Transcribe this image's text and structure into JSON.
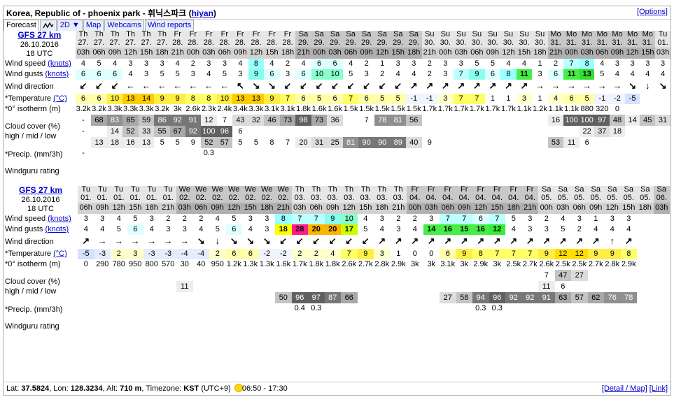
{
  "header": {
    "title": "Korea, Republic of - phoenix park - 휘닉스파크",
    "user_prefix": "(",
    "user": "hiyan",
    "user_suffix": ")",
    "options": "[Options]"
  },
  "tabs": [
    {
      "label": "Forecast",
      "active": true
    },
    {
      "label": "",
      "icon": "graph-icon"
    },
    {
      "label": "2D ▼"
    },
    {
      "label": "Map"
    },
    {
      "label": "Webcams"
    },
    {
      "label": "Wind reports"
    }
  ],
  "labels": {
    "wind_speed": "Wind speed",
    "wind_gusts": "Wind gusts",
    "knots": "(knots)",
    "wind_direction": "Wind direction",
    "temperature": "*Temperature",
    "deg_c": "(°C)",
    "isotherm": "*0° isotherm (m)",
    "cloud_cover_1": "Cloud cover (%)",
    "cloud_cover_2": "high / mid / low",
    "precip": "*Precip. (mm/3h)",
    "rating": "Windguru rating"
  },
  "colors": {
    "cloud": [
      "#ffffff",
      "#dcdcdc",
      "#c0c0c0",
      "#a0a0a0",
      "#808080",
      "#606060"
    ],
    "temp_warm": "#ffff80",
    "temp_hot": "#ffd200",
    "temp_cold": "#e0e8ff"
  },
  "sections": [
    {
      "model": "GFS 27 km",
      "date": "26.10.2016",
      "run": "18 UTC",
      "days": [
        "Th",
        "Th",
        "Th",
        "Th",
        "Th",
        "Th",
        "Fr",
        "Fr",
        "Fr",
        "Fr",
        "Fr",
        "Fr",
        "Fr",
        "Fr",
        "Sa",
        "Sa",
        "Sa",
        "Sa",
        "Sa",
        "Sa",
        "Sa",
        "Sa",
        "Su",
        "Su",
        "Su",
        "Su",
        "Su",
        "Su",
        "Su",
        "Su",
        "Mo",
        "Mo",
        "Mo",
        "Mo",
        "Mo",
        "Mo",
        "Mo",
        "Tu"
      ],
      "dates": [
        "27.",
        "27.",
        "27.",
        "27.",
        "27.",
        "27.",
        "28.",
        "28.",
        "28.",
        "28.",
        "28.",
        "28.",
        "28.",
        "28.",
        "29.",
        "29.",
        "29.",
        "29.",
        "29.",
        "29.",
        "29.",
        "29.",
        "30.",
        "30.",
        "30.",
        "30.",
        "30.",
        "30.",
        "30.",
        "30.",
        "31.",
        "31.",
        "31.",
        "31.",
        "31.",
        "31.",
        "31.",
        "01."
      ],
      "hours": [
        "03h",
        "06h",
        "09h",
        "12h",
        "15h",
        "18h",
        "21h",
        "00h",
        "03h",
        "06h",
        "09h",
        "12h",
        "15h",
        "18h",
        "21h",
        "00h",
        "03h",
        "06h",
        "09h",
        "12h",
        "15h",
        "18h",
        "21h",
        "00h",
        "03h",
        "06h",
        "09h",
        "12h",
        "15h",
        "18h",
        "21h",
        "00h",
        "03h",
        "06h",
        "09h",
        "12h",
        "15h",
        "03h"
      ],
      "weekend": [
        0,
        0,
        0,
        0,
        0,
        0,
        0,
        0,
        0,
        0,
        0,
        0,
        0,
        0,
        1,
        1,
        1,
        1,
        1,
        1,
        1,
        1,
        0,
        0,
        0,
        0,
        0,
        0,
        0,
        0,
        1,
        1,
        1,
        1,
        1,
        1,
        1,
        0
      ],
      "wind_speed": [
        4,
        5,
        4,
        3,
        3,
        3,
        4,
        2,
        3,
        3,
        4,
        8,
        4,
        2,
        4,
        6,
        6,
        4,
        2,
        1,
        3,
        3,
        2,
        3,
        3,
        5,
        5,
        4,
        4,
        1,
        2,
        7,
        8,
        4,
        3,
        3,
        3,
        3
      ],
      "wind_gusts": [
        6,
        6,
        6,
        4,
        3,
        5,
        5,
        3,
        4,
        5,
        3,
        9,
        6,
        3,
        6,
        10,
        10,
        5,
        3,
        2,
        4,
        4,
        2,
        3,
        7,
        9,
        6,
        8,
        11,
        3,
        6,
        11,
        13,
        5,
        4,
        4,
        4,
        4
      ],
      "wind_dir": [
        "↙",
        "↙",
        "↙",
        "←",
        "←",
        "←",
        "←",
        "←",
        "←",
        "←",
        "↖",
        "↘",
        "↘",
        "↙",
        "↙",
        "↙",
        "↙",
        "↙",
        "↙",
        "↙",
        "↙",
        "↗",
        "↗",
        "↗",
        "↗",
        "↗",
        "↗",
        "↗",
        "↗",
        "→",
        "→",
        "→",
        "→",
        "→",
        "→",
        "↘",
        "↓",
        "↘"
      ],
      "temperature": [
        "6",
        "6",
        "10",
        "13",
        "14",
        "9",
        "9",
        "8",
        "8",
        "10",
        "13",
        "13",
        "9",
        "7",
        "6",
        "5",
        "6",
        "7",
        "6",
        "5",
        "5",
        "-1",
        "-1",
        "3",
        "7",
        "7",
        "1",
        "1",
        "3",
        "1",
        "4",
        "6",
        "5",
        "-1",
        "-2",
        "-5",
        "",
        ""
      ],
      "isotherm": [
        "3.2k",
        "3.2k",
        "3.3k",
        "3.3k",
        "3.3k",
        "3.2k",
        "3k",
        "2.6k",
        "2.3k",
        "2.4k",
        "3.4k",
        "3.3k",
        "3.1k",
        "3.1k",
        "1.8k",
        "1.6k",
        "1.6k",
        "1.5k",
        "1.5k",
        "1.5k",
        "1.5k",
        "1.5k",
        "1.7k",
        "1.7k",
        "1.7k",
        "1.7k",
        "1.7k",
        "1.7k",
        "1.1k",
        "1.2k",
        "1.1k",
        "1.1k",
        "880",
        "320",
        "0",
        "",
        "",
        ""
      ],
      "cloud_high": [
        "-",
        "68",
        "83",
        "65",
        "59",
        "86",
        "92",
        "91",
        "12",
        "7",
        "43",
        "32",
        "46",
        "73",
        "98",
        "73",
        "36",
        "",
        "7",
        "78",
        "81",
        "56",
        "",
        "",
        "",
        "",
        "",
        "",
        "",
        "",
        "16",
        "100",
        "100",
        "97",
        "48",
        "14",
        "45",
        "31"
      ],
      "cloud_mid": [
        "-",
        "",
        "14",
        "52",
        "33",
        "55",
        "67",
        "92",
        "100",
        "96",
        "6",
        "",
        "",
        "",
        "",
        "",
        "",
        "",
        "",
        "",
        "",
        "",
        "",
        "",
        "",
        "",
        "",
        "",
        "",
        "",
        "",
        "",
        "22",
        "37",
        "18",
        "",
        "",
        ""
      ],
      "cloud_low": [
        "",
        "13",
        "18",
        "16",
        "13",
        "5",
        "5",
        "9",
        "52",
        "57",
        "5",
        "5",
        "8",
        "7",
        "20",
        "31",
        "25",
        "81",
        "90",
        "90",
        "89",
        "40",
        "9",
        "",
        "",
        "",
        "",
        "",
        "",
        "",
        "53",
        "11",
        "6",
        "",
        "",
        "",
        "",
        ""
      ],
      "precip": [
        "-",
        "",
        "",
        "",
        "",
        "",
        "",
        "",
        "0.3",
        "",
        "",
        "",
        "",
        "",
        "",
        "",
        "",
        "",
        "",
        "",
        "",
        "",
        "",
        "",
        "",
        "",
        "",
        "",
        "",
        "",
        "",
        "",
        "",
        "",
        "",
        "",
        "",
        ""
      ]
    },
    {
      "model": "GFS 27 km",
      "date": "26.10.2016",
      "run": "18 UTC",
      "days": [
        "Tu",
        "Tu",
        "Tu",
        "Tu",
        "Tu",
        "Tu",
        "We",
        "We",
        "We",
        "We",
        "We",
        "We",
        "We",
        "Th",
        "Th",
        "Th",
        "Th",
        "Th",
        "Th",
        "Th",
        "Fr",
        "Fr",
        "Fr",
        "Fr",
        "Fr",
        "Fr",
        "Fr",
        "Fr",
        "Sa",
        "Sa",
        "Sa",
        "Sa",
        "Sa",
        "Sa",
        "Sa",
        "Sa"
      ],
      "dates": [
        "01.",
        "01.",
        "01.",
        "01.",
        "01.",
        "01.",
        "02.",
        "02.",
        "02.",
        "02.",
        "02.",
        "02.",
        "02.",
        "03.",
        "03.",
        "03.",
        "03.",
        "03.",
        "03.",
        "03.",
        "04.",
        "04.",
        "04.",
        "04.",
        "04.",
        "04.",
        "04.",
        "04.",
        "05.",
        "05.",
        "05.",
        "05.",
        "05.",
        "05.",
        "05.",
        "06."
      ],
      "hours": [
        "06h",
        "09h",
        "12h",
        "15h",
        "18h",
        "21h",
        "03h",
        "06h",
        "09h",
        "12h",
        "15h",
        "18h",
        "21h",
        "03h",
        "06h",
        "09h",
        "12h",
        "15h",
        "18h",
        "21h",
        "00h",
        "03h",
        "06h",
        "09h",
        "12h",
        "15h",
        "18h",
        "21h",
        "00h",
        "03h",
        "06h",
        "09h",
        "12h",
        "15h",
        "18h",
        "03h"
      ],
      "weekend": [
        0,
        0,
        0,
        0,
        0,
        0,
        1,
        1,
        1,
        1,
        1,
        1,
        1,
        0,
        0,
        0,
        0,
        0,
        0,
        0,
        1,
        1,
        1,
        1,
        1,
        1,
        1,
        1,
        0,
        0,
        0,
        0,
        0,
        0,
        0,
        1
      ],
      "wind_speed": [
        3,
        3,
        4,
        5,
        3,
        2,
        2,
        2,
        4,
        5,
        3,
        3,
        8,
        7,
        7,
        9,
        10,
        4,
        3,
        2,
        2,
        3,
        7,
        7,
        6,
        7,
        5,
        3,
        2,
        4,
        3,
        1,
        3,
        3,
        "",
        ""
      ],
      "wind_gusts": [
        4,
        4,
        5,
        6,
        4,
        3,
        3,
        4,
        5,
        6,
        4,
        3,
        18,
        28,
        20,
        20,
        17,
        5,
        4,
        3,
        4,
        14,
        16,
        15,
        16,
        12,
        4,
        3,
        3,
        5,
        2,
        4,
        4,
        4,
        "",
        ""
      ],
      "wind_dir": [
        "↗",
        "→",
        "→",
        "→",
        "→",
        "→",
        "→",
        "↘",
        "↓",
        "↘",
        "↘",
        "↘",
        "↙",
        "↙",
        "↙",
        "↙",
        "↙",
        "↙",
        "↗",
        "↗",
        "↗",
        "↗",
        "↗",
        "↗",
        "↗",
        "↗",
        "↗",
        "↗",
        "↗",
        "↗",
        "↗",
        "↗",
        "↑",
        "↗",
        "",
        ""
      ],
      "temperature": [
        "-5",
        "-3",
        "2",
        "3",
        "-3",
        "-3",
        "-4",
        "-4",
        "2",
        "6",
        "6",
        "-2",
        "-2",
        "2",
        "2",
        "4",
        "7",
        "9",
        "3",
        "1",
        "0",
        "0",
        "6",
        "9",
        "8",
        "7",
        "7",
        "7",
        "9",
        "12",
        "12",
        "9",
        "9",
        "8",
        "",
        ""
      ],
      "isotherm": [
        "0",
        "290",
        "780",
        "950",
        "800",
        "570",
        "30",
        "40",
        "950",
        "1.2k",
        "1.3k",
        "1.3k",
        "1.6k",
        "1.7k",
        "1.8k",
        "1.8k",
        "2.6k",
        "2.7k",
        "2.8k",
        "2.9k",
        "3k",
        "3k",
        "3.1k",
        "3k",
        "2.9k",
        "3k",
        "2.5k",
        "2.7k",
        "2.6k",
        "2.5k",
        "2.5k",
        "2.7k",
        "2.8k",
        "2.9k",
        "",
        ""
      ],
      "cloud_high": [
        "",
        "",
        "",
        "",
        "",
        "",
        "",
        "",
        "",
        "",
        "",
        "",
        "",
        "",
        "",
        "",
        "",
        "",
        "",
        "",
        "",
        "",
        "",
        "",
        "",
        "",
        "",
        "",
        "7",
        "47",
        "27",
        "",
        "",
        "",
        "",
        ""
      ],
      "cloud_mid": [
        "",
        "",
        "",
        "",
        "",
        "",
        "11",
        "",
        "",
        "",
        "",
        "",
        "",
        "",
        "",
        "",
        "",
        "",
        "",
        "",
        "",
        "",
        "",
        "",
        "",
        "",
        "",
        "",
        "11",
        "6",
        "",
        "",
        "",
        "",
        "",
        ""
      ],
      "cloud_low": [
        "",
        "",
        "",
        "",
        "",
        "",
        "",
        "",
        "",
        "",
        "",
        "",
        "50",
        "96",
        "97",
        "87",
        "66",
        "",
        "",
        "",
        "",
        "",
        "27",
        "58",
        "94",
        "96",
        "92",
        "92",
        "91",
        "63",
        "57",
        "62",
        "76",
        "78",
        "",
        ""
      ],
      "precip": [
        "",
        "",
        "",
        "",
        "",
        "",
        "",
        "",
        "",
        "",
        "",
        "",
        "",
        "0.4",
        "0.3",
        "",
        "",
        "",
        "",
        "",
        "",
        "",
        "",
        "",
        "0.3",
        "0.3",
        "",
        "",
        "",
        "",
        "",
        "",
        "",
        "",
        "",
        ""
      ]
    }
  ],
  "footer": {
    "lat_label": "Lat:",
    "lat": "37.5824",
    "lon_label": ", Lon:",
    "lon": "128.3234",
    "alt_label": ", Alt:",
    "alt": "710 m",
    "tz_label": ", Timezone:",
    "tz": "KST",
    "tz_offset": "(UTC+9)",
    "sun": "06:50 - 17:30",
    "detail_map": "[Detail / Map]",
    "link": "[Link]"
  }
}
